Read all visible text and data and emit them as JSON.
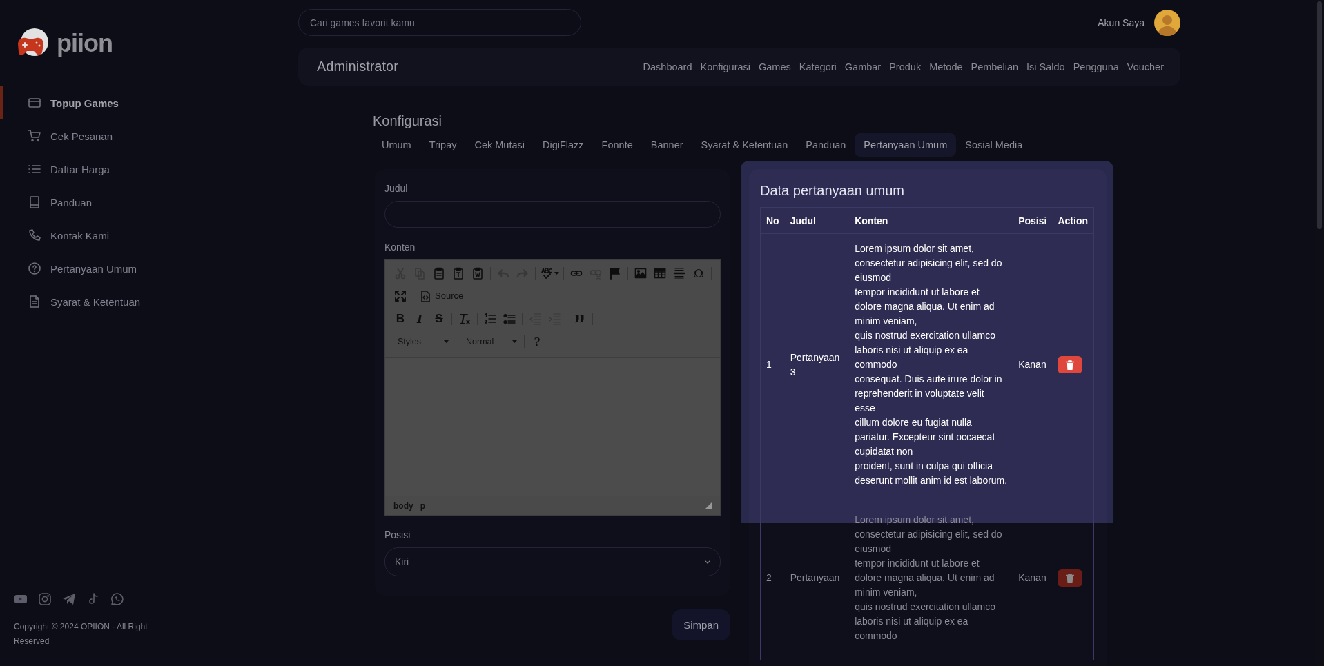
{
  "sidebar": {
    "logo_text": "piion",
    "items": [
      {
        "label": "Topup Games",
        "selected": true
      },
      {
        "label": "Cek Pesanan",
        "selected": false
      },
      {
        "label": "Daftar Harga",
        "selected": false
      },
      {
        "label": "Panduan",
        "selected": false
      },
      {
        "label": "Kontak Kami",
        "selected": false
      },
      {
        "label": "Pertanyaan Umum",
        "selected": false
      },
      {
        "label": "Syarat & Ketentuan",
        "selected": false
      }
    ],
    "copyright": "Copyright © 2024 OPIION - All Right Reserved"
  },
  "topbar": {
    "search": {
      "placeholder": "Cari games favorit kamu"
    },
    "account": "Akun Saya"
  },
  "admin_bar": {
    "title": "Administrator",
    "links": [
      "Dashboard",
      "Konfigurasi",
      "Games",
      "Kategori",
      "Gambar",
      "Produk",
      "Metode",
      "Pembelian",
      "Isi Saldo",
      "Pengguna",
      "Voucher"
    ]
  },
  "page_title": "Konfigurasi",
  "tabs": [
    {
      "label": "Umum",
      "selected": false
    },
    {
      "label": "Tripay",
      "selected": false
    },
    {
      "label": "Cek Mutasi",
      "selected": false
    },
    {
      "label": "DigiFlazz",
      "selected": false
    },
    {
      "label": "Fonnte",
      "selected": false
    },
    {
      "label": "Banner",
      "selected": false
    },
    {
      "label": "Syarat & Ketentuan",
      "selected": false
    },
    {
      "label": "Panduan",
      "selected": false
    },
    {
      "label": "Pertanyaan Umum",
      "selected": true
    },
    {
      "label": "Sosial Media",
      "selected": false
    }
  ],
  "form": {
    "judul_label": "Judul",
    "konten_label": "Konten",
    "editor": {
      "toolbar_rows": [
        [
          {
            "kind": "cut",
            "disabled": true
          },
          {
            "kind": "copy",
            "disabled": true
          },
          {
            "kind": "paste",
            "disabled": false
          },
          {
            "kind": "paste-text",
            "disabled": false
          },
          {
            "kind": "paste-word",
            "disabled": false
          },
          {
            "kind": "separator"
          },
          {
            "kind": "undo",
            "disabled": true
          },
          {
            "kind": "redo",
            "disabled": true
          },
          {
            "kind": "separator"
          },
          {
            "kind": "spellcheck",
            "disabled": false
          },
          {
            "kind": "separator"
          },
          {
            "kind": "link",
            "disabled": false
          },
          {
            "kind": "unlink",
            "disabled": true
          },
          {
            "kind": "anchor",
            "disabled": false
          },
          {
            "kind": "separator"
          },
          {
            "kind": "image",
            "disabled": false
          },
          {
            "kind": "table",
            "disabled": false
          },
          {
            "kind": "hr",
            "disabled": false
          },
          {
            "kind": "symbol",
            "label": "Ω",
            "disabled": false
          },
          {
            "kind": "separator"
          }
        ],
        [
          {
            "kind": "maximize",
            "disabled": false
          },
          {
            "kind": "separator"
          },
          {
            "kind": "source",
            "label": "Source",
            "disabled": false
          },
          {
            "kind": "separator"
          }
        ],
        [
          {
            "kind": "bold",
            "label": "B",
            "disabled": false
          },
          {
            "kind": "italic",
            "label": "I",
            "disabled": false
          },
          {
            "kind": "strike",
            "label": "S",
            "disabled": false
          },
          {
            "kind": "separator"
          },
          {
            "kind": "remove-format",
            "disabled": false
          },
          {
            "kind": "separator"
          },
          {
            "kind": "numbered-list",
            "disabled": false
          },
          {
            "kind": "bulleted-list",
            "disabled": false
          },
          {
            "kind": "separator"
          },
          {
            "kind": "outdent",
            "disabled": true
          },
          {
            "kind": "indent",
            "disabled": true
          },
          {
            "kind": "separator"
          },
          {
            "kind": "blockquote",
            "disabled": false
          },
          {
            "kind": "separator"
          }
        ],
        [
          {
            "kind": "combo",
            "label": "Styles"
          },
          {
            "kind": "separator"
          },
          {
            "kind": "combo",
            "label": "Normal"
          },
          {
            "kind": "separator"
          },
          {
            "kind": "help",
            "label": "?",
            "disabled": false
          }
        ]
      ],
      "path": [
        "body",
        "p"
      ]
    },
    "posisi_label": "Posisi",
    "posisi_value": "Kiri"
  },
  "save_button": "Simpan",
  "faq_card": {
    "highlighted": true,
    "title": "Data pertanyaan umum",
    "columns": [
      "No",
      "Judul",
      "Konten",
      "Posisi",
      "Action"
    ],
    "rows": [
      {
        "no": "1",
        "judul": "Pertanyaan 3",
        "konten": "Lorem ipsum dolor sit amet, consectetur adipisicing elit, sed do eiusmod\ntempor incididunt ut labore et dolore magna aliqua. Ut enim ad minim veniam,\nquis nostrud exercitation ullamco laboris nisi ut aliquip ex ea commodo\nconsequat. Duis aute irure dolor in reprehenderit in voluptate velit esse\ncillum dolore eu fugiat nulla pariatur. Excepteur sint occaecat cupidatat non\nproident, sunt in culpa qui officia deserunt mollit anim id est laborum.",
        "posisi": "Kanan",
        "highlighted": true
      },
      {
        "highlighted": false,
        "no": "2",
        "judul": "Pertanyaan",
        "konten": "Lorem ipsum dolor sit amet, consectetur adipisicing elit, sed do eiusmod\ntempor incididunt ut labore et dolore magna aliqua. Ut enim ad minim veniam,\nquis nostrud exercitation ullamco laboris nisi ut aliquip ex ea commodo",
        "posisi": "Kanan"
      }
    ]
  }
}
